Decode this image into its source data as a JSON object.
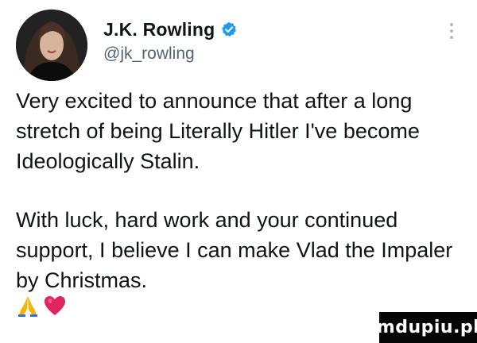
{
  "tweet": {
    "display_name": "J.K. Rowling",
    "handle": "@jk_rowling",
    "verified_icon": "verified-badge-icon",
    "more_icon": "more-options-icon",
    "paragraphs": [
      "Very excited to announce that after a long stretch of being Literally Hitler I've become Ideologically Stalin.",
      "With luck, hard work and your continued support, I believe I can make Vlad the Impaler by Christmas."
    ],
    "emojis": [
      "praying-hands-icon",
      "red-heart-icon"
    ]
  },
  "watermark": {
    "text": "mdupiu.pl"
  },
  "colors": {
    "text": "#0f1419",
    "handle": "#536471",
    "verified": "#1d9bf0",
    "heart": "#e0245e",
    "watermark_bg": "#050505"
  }
}
